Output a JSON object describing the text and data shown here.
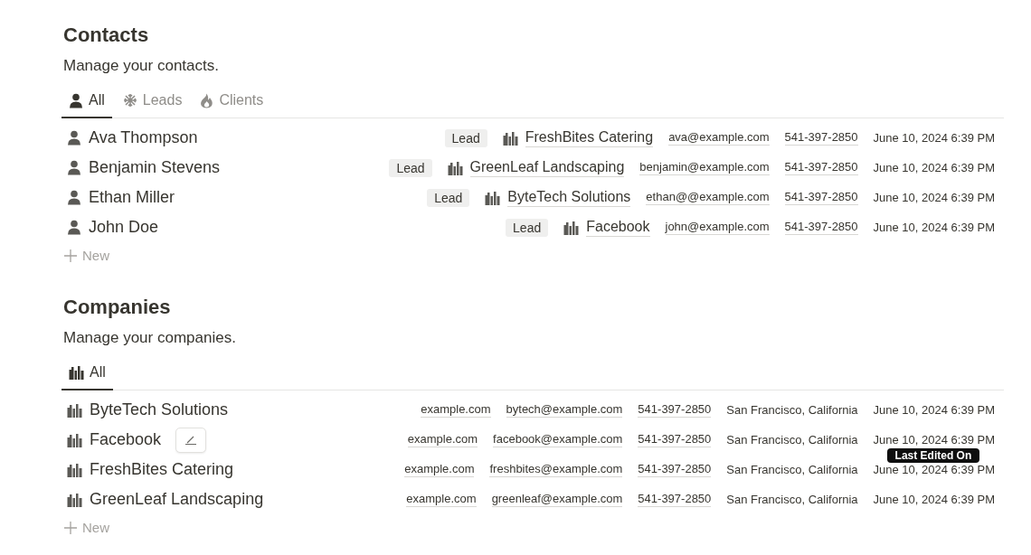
{
  "contacts": {
    "title": "Contacts",
    "description": "Manage your contacts.",
    "tabs": [
      {
        "label": "All",
        "kind": "person",
        "selected": true
      },
      {
        "label": "Leads",
        "kind": "snowflake",
        "selected": false
      },
      {
        "label": "Clients",
        "kind": "fire",
        "selected": false
      }
    ],
    "rows": [
      {
        "name": "Ava Thompson",
        "tag": "Lead",
        "company": "FreshBites Catering",
        "email": "ava@example.com",
        "phone": "541-397-2850",
        "edited": "June 10, 2024 6:39 PM"
      },
      {
        "name": "Benjamin Stevens",
        "tag": "Lead",
        "company": "GreenLeaf Landscaping",
        "email": "benjamin@example.com",
        "phone": "541-397-2850",
        "edited": "June 10, 2024 6:39 PM"
      },
      {
        "name": "Ethan Miller",
        "tag": "Lead",
        "company": "ByteTech Solutions",
        "email": "ethan@@example.com",
        "phone": "541-397-2850",
        "edited": "June 10, 2024 6:39 PM"
      },
      {
        "name": "John Doe",
        "tag": "Lead",
        "company": "Facebook",
        "email": "john@example.com",
        "phone": "541-397-2850",
        "edited": "June 10, 2024 6:39 PM"
      }
    ],
    "new_label": "New"
  },
  "companies": {
    "title": "Companies",
    "description": "Manage your companies.",
    "tabs": [
      {
        "label": "All",
        "kind": "building",
        "selected": true
      }
    ],
    "rows": [
      {
        "name": "ByteTech Solutions",
        "hovered": false,
        "website": "example.com",
        "email": "bytech@example.com",
        "phone": "541-397-2850",
        "location": "San Francisco, California",
        "edited": "June 10, 2024 6:39 PM"
      },
      {
        "name": "Facebook",
        "hovered": true,
        "website": "example.com",
        "email": "facebook@example.com",
        "phone": "541-397-2850",
        "location": "San Francisco, California",
        "edited": "June 10, 2024 6:39 PM",
        "tooltip": "Last Edited On"
      },
      {
        "name": "FreshBites Catering",
        "hovered": false,
        "website": "example.com",
        "email": "freshbites@example.com",
        "phone": "541-397-2850",
        "location": "San Francisco, California",
        "edited": "June 10, 2024 6:39 PM"
      },
      {
        "name": "GreenLeaf Landscaping",
        "hovered": false,
        "website": "example.com",
        "email": "greenleaf@example.com",
        "phone": "541-397-2850",
        "location": "San Francisco, California",
        "edited": "June 10, 2024 6:39 PM"
      }
    ],
    "new_label": "New"
  }
}
